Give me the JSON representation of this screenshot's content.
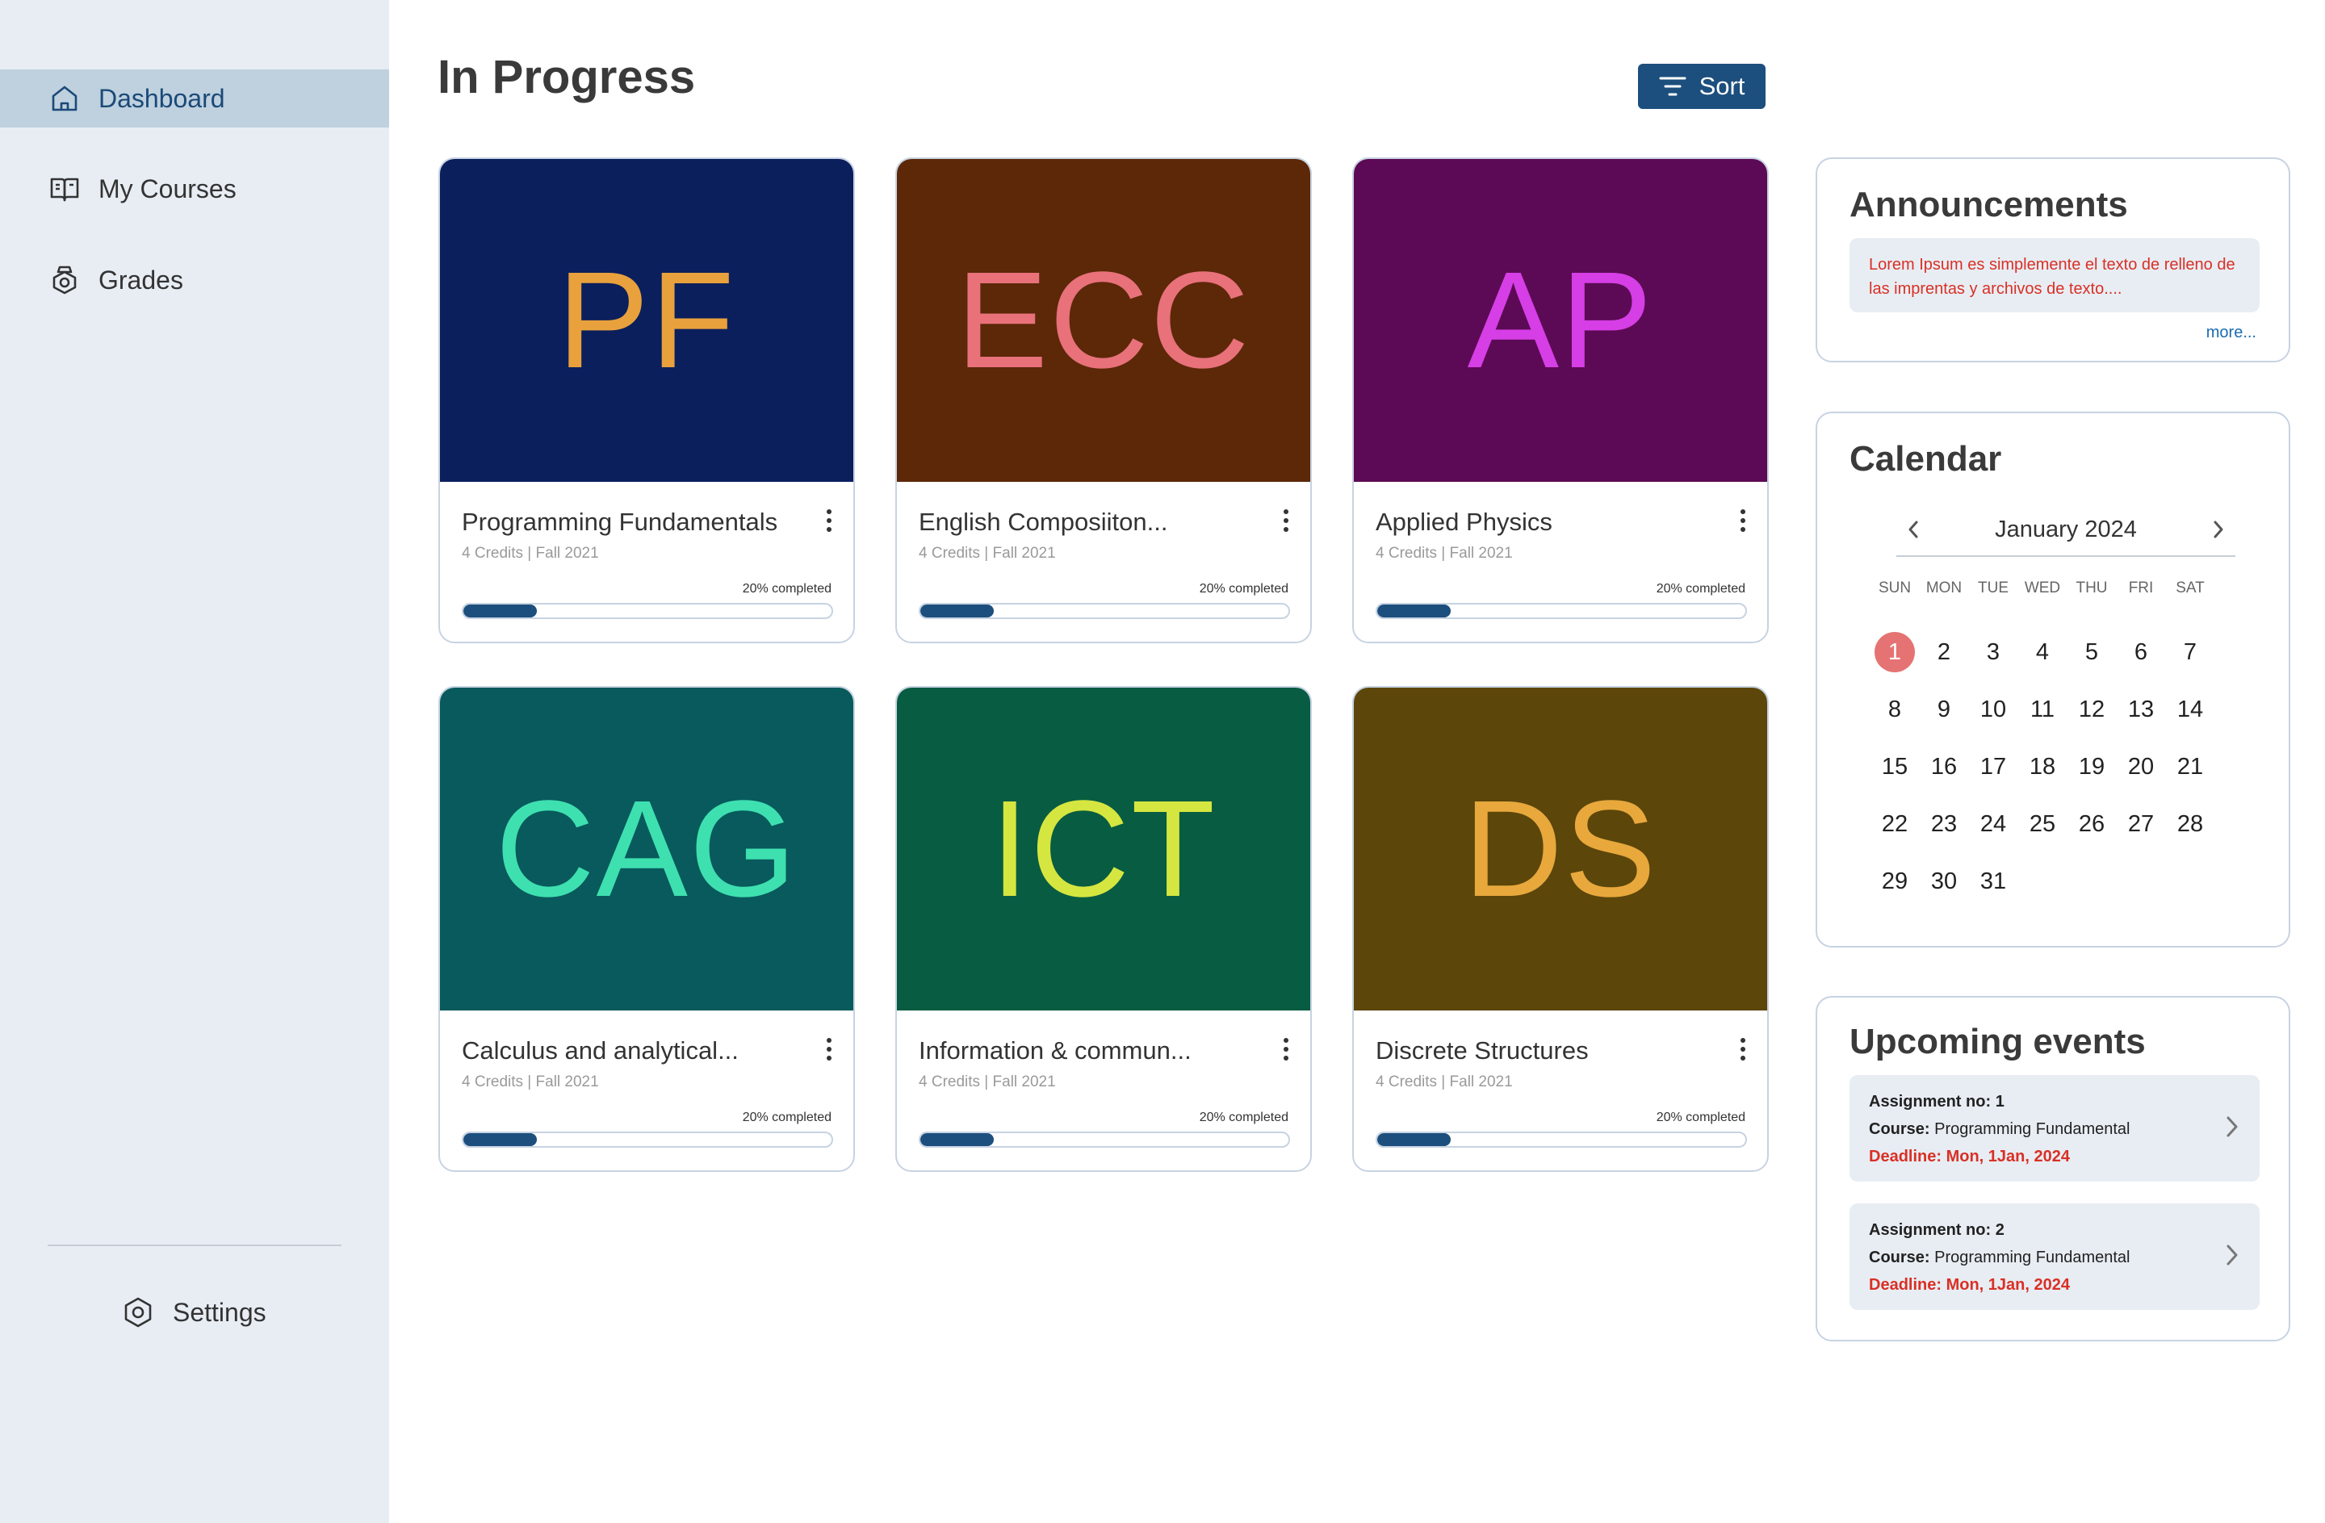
{
  "sidebar": {
    "items": [
      {
        "label": "Dashboard",
        "icon": "home-icon",
        "active": true
      },
      {
        "label": "My Courses",
        "icon": "book-icon",
        "active": false
      },
      {
        "label": "Grades",
        "icon": "grades-icon",
        "active": false
      }
    ],
    "settings_label": "Settings"
  },
  "header": {
    "title": "In Progress",
    "sort_label": "Sort"
  },
  "courses": [
    {
      "code": "PF",
      "title": "Programming Fundamentals",
      "meta": "4 Credits | Fall 2021",
      "progress_text": "20% completed",
      "progress": 0.2,
      "bg": "#0b1f5c",
      "fg": "#e8a13c"
    },
    {
      "code": "ECC",
      "title": "English Composiiton...",
      "meta": "4 Credits | Fall 2021",
      "progress_text": "20% completed",
      "progress": 0.2,
      "bg": "#5c2808",
      "fg": "#e8717a"
    },
    {
      "code": "AP",
      "title": "Applied Physics",
      "meta": "4 Credits | Fall 2021",
      "progress_text": "20% completed",
      "progress": 0.2,
      "bg": "#5c0a55",
      "fg": "#d63ee6"
    },
    {
      "code": "CAG",
      "title": "Calculus and analytical...",
      "meta": "4 Credits | Fall 2021",
      "progress_text": "20% completed",
      "progress": 0.2,
      "bg": "#085a5c",
      "fg": "#3ee0b0"
    },
    {
      "code": "ICT",
      "title": "Information & commun...",
      "meta": "4 Credits | Fall 2021",
      "progress_text": "20% completed",
      "progress": 0.2,
      "bg": "#085c42",
      "fg": "#d6e640"
    },
    {
      "code": "DS",
      "title": "Discrete Structures",
      "meta": "4 Credits | Fall 2021",
      "progress_text": "20% completed",
      "progress": 0.2,
      "bg": "#5c460a",
      "fg": "#e8a83c"
    }
  ],
  "announcements": {
    "title": "Announcements",
    "text": "Lorem Ipsum es simplemente el texto de relleno de las imprentas y archivos de texto....",
    "more_label": "more..."
  },
  "calendar": {
    "title": "Calendar",
    "month": "January 2024",
    "weekdays": [
      "SUN",
      "MON",
      "TUE",
      "WED",
      "THU",
      "FRI",
      "SAT"
    ],
    "days": [
      "1",
      "2",
      "3",
      "4",
      "5",
      "6",
      "7",
      "8",
      "9",
      "10",
      "11",
      "12",
      "13",
      "14",
      "15",
      "16",
      "17",
      "18",
      "19",
      "20",
      "21",
      "22",
      "23",
      "24",
      "25",
      "26",
      "27",
      "28",
      "29",
      "30",
      "31"
    ],
    "highlighted_day": "1"
  },
  "events": {
    "title": "Upcoming events",
    "items": [
      {
        "assignment_label": "Assignment no:",
        "assignment_no": "1",
        "course_label": "Course:",
        "course": "Programming Fundamental",
        "deadline": "Deadline: Mon, 1Jan, 2024"
      },
      {
        "assignment_label": "Assignment no:",
        "assignment_no": "2",
        "course_label": "Course:",
        "course": "Programming Fundamental",
        "deadline": "Deadline: Mon, 1Jan, 2024"
      }
    ]
  },
  "colors": {
    "accent": "#1c4f7e",
    "sidebar_bg": "#e8edf4",
    "sidebar_active": "#bfd0de",
    "deadline": "#d93025",
    "today": "#e57373"
  }
}
